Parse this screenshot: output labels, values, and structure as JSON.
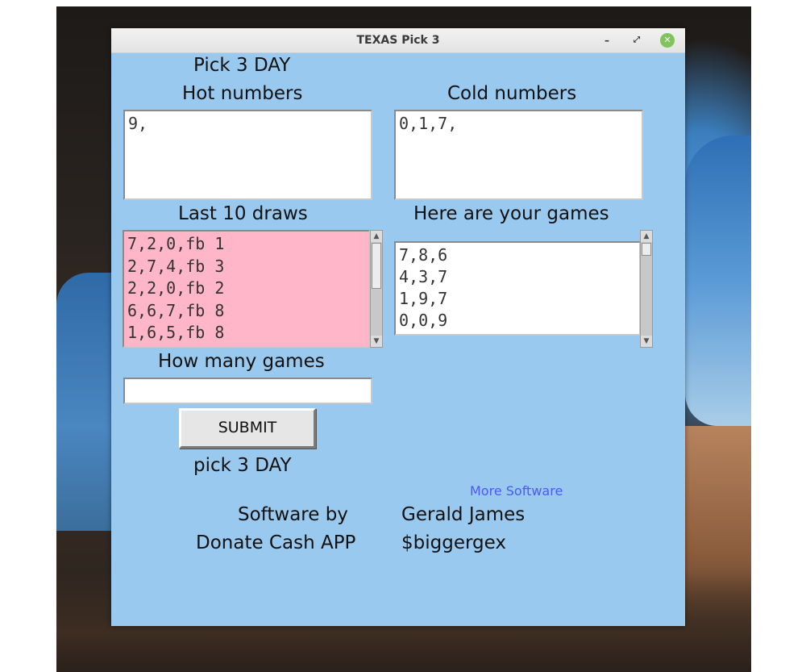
{
  "window": {
    "title": "TEXAS Pick 3",
    "controls": {
      "minimize": "–",
      "maximize": "⤢",
      "close": "✕"
    }
  },
  "header": {
    "game_label": "Pick 3 DAY"
  },
  "hot": {
    "label": "Hot numbers",
    "value": "9,"
  },
  "cold": {
    "label": "Cold numbers",
    "value": "0,1,7,"
  },
  "draws": {
    "label": "Last 10 draws",
    "items": [
      "7,2,0,fb 1",
      "2,7,4,fb 3",
      "2,2,0,fb 2",
      "6,6,7,fb 8",
      "1,6,5,fb 8"
    ]
  },
  "games": {
    "label": "Here are your games",
    "items": [
      "7,8,6",
      "4,3,7",
      "1,9,7",
      "0,0,9"
    ]
  },
  "how_many": {
    "label": "How many games",
    "value": ""
  },
  "submit": {
    "label": "SUBMIT"
  },
  "footer": {
    "game_label": "pick 3 DAY",
    "more_software": "More Software",
    "software_by_label": "Software by",
    "author": "Gerald James",
    "donate_label": "Donate Cash APP",
    "cashtag": "$biggergex"
  },
  "colors": {
    "window_bg": "#9ac9ef",
    "draws_bg": "#ffb6c8",
    "link": "#4a5bf5"
  }
}
